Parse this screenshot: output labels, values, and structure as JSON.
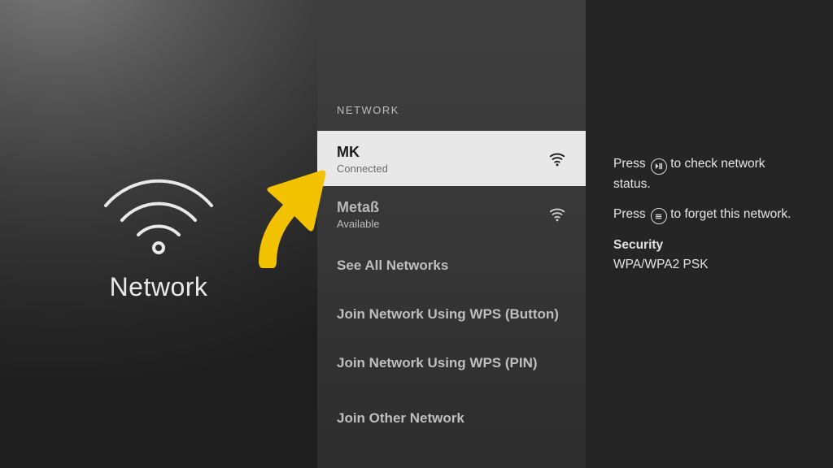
{
  "left": {
    "title": "Network"
  },
  "mid": {
    "section_label": "NETWORK",
    "networks": [
      {
        "name": "MK",
        "status": "Connected",
        "selected": true
      },
      {
        "name": "Metaß",
        "status": "Available",
        "selected": false
      }
    ],
    "actions": [
      "See All Networks",
      "Join Network Using WPS (Button)",
      "Join Network Using WPS (PIN)",
      "Join Other Network"
    ]
  },
  "right": {
    "hint1_prefix": "Press",
    "hint1_suffix": " to check network status.",
    "hint2_prefix": "Press",
    "hint2_suffix": " to forget this network.",
    "security_label": "Security",
    "security_value": "WPA/WPA2 PSK"
  },
  "annotation": {
    "arrow_color": "#f2c100"
  }
}
